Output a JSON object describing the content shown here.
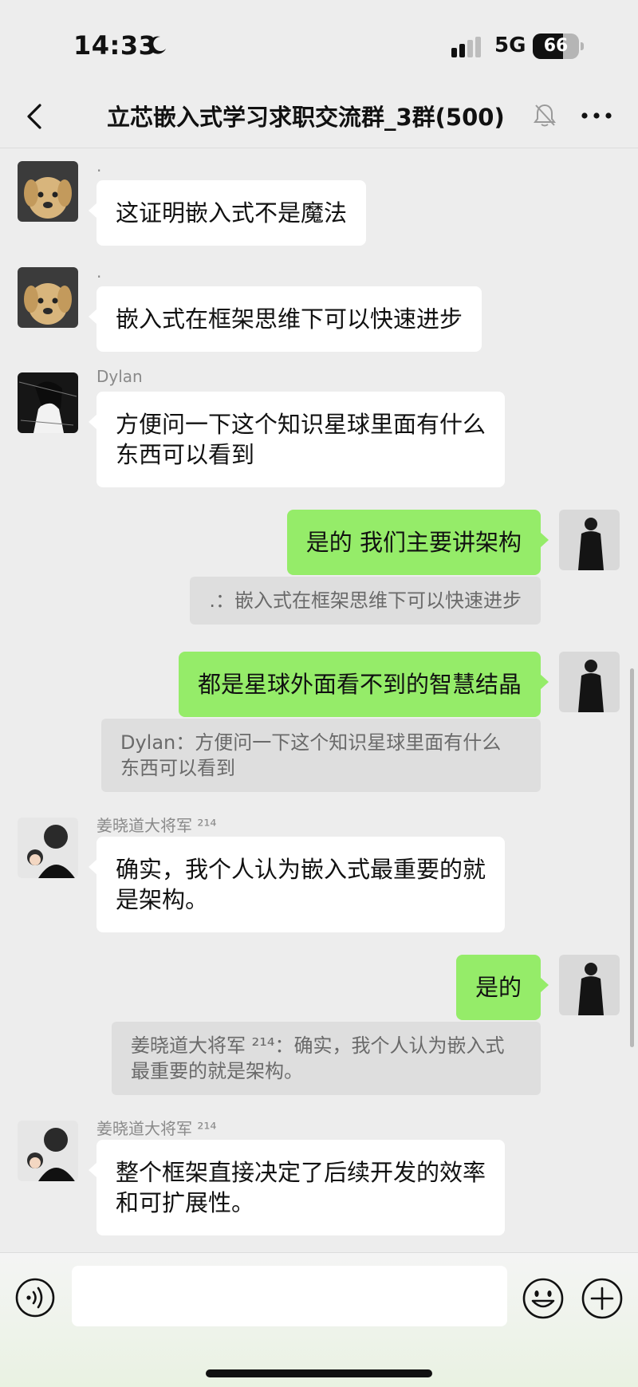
{
  "status_bar": {
    "time": "14:33",
    "network": "5G",
    "battery": "66",
    "battery_level": 0.66
  },
  "header": {
    "title": "立芯嵌入式学习求职交流群_3群(500)",
    "icons": [
      "back-icon",
      "mute-bell-icon",
      "more-icon"
    ]
  },
  "messages": [
    {
      "sender": ".",
      "text": "这证明嵌入式不是魔法",
      "direction": "in"
    },
    {
      "sender": ".",
      "text": "嵌入式在框架思维下可以快速进步",
      "direction": "in"
    },
    {
      "sender": "Dylan",
      "lines": [
        "方便问一下这个知识星球里面有什么",
        "东西可以看到"
      ],
      "direction": "in"
    },
    {
      "text": "是的 我们主要讲架构",
      "direction": "out",
      "quote": ".：嵌入式在框架思维下可以快速进步"
    },
    {
      "text": "都是星球外面看不到的智慧结晶",
      "direction": "out",
      "quote_lines": [
        "Dylan：方便问一下这个知识星球里面有什么",
        "东西可以看到"
      ]
    },
    {
      "sender": "姜晓道大将军 ²¹⁴",
      "lines": [
        "确实，我个人认为嵌入式最重要的就",
        "是架构。"
      ],
      "direction": "in"
    },
    {
      "text": "是的",
      "direction": "out",
      "quote_lines": [
        "姜晓道大将军 ²¹⁴：确实，我个人认为嵌入式",
        "最重要的就是架构。"
      ]
    },
    {
      "sender": "姜晓道大将军 ²¹⁴",
      "lines": [
        "整个框架直接决定了后续开发的效率",
        "和可扩展性。"
      ],
      "direction": "in"
    }
  ],
  "colors": {
    "background": "#ededed",
    "outgoing_bubble": "#95ec69",
    "incoming_bubble": "#ffffff",
    "quote_bg": "#dedede"
  },
  "input": {
    "value": "",
    "icons": [
      "voice-icon",
      "emoji-icon",
      "add-icon"
    ]
  }
}
